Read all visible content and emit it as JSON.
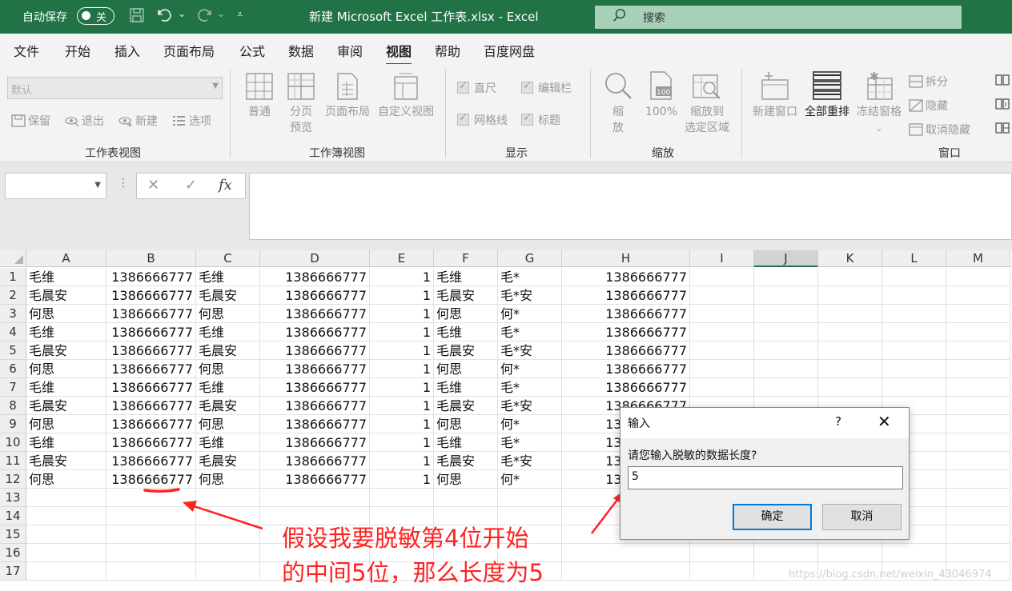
{
  "titlebar": {
    "autosave_label": "自动保存",
    "autosave_state": "关",
    "doc_title": "新建 Microsoft Excel 工作表.xlsx  -  Excel",
    "search_placeholder": "搜索"
  },
  "menu": [
    "文件",
    "开始",
    "插入",
    "页面布局",
    "公式",
    "数据",
    "审阅",
    "视图",
    "帮助",
    "百度网盘"
  ],
  "active_menu": "视图",
  "ribbon": {
    "sheet_view": {
      "select_value": "默认",
      "keep": "保留",
      "exit": "退出",
      "new": "新建",
      "options": "选项",
      "label": "工作表视图"
    },
    "workbook_view": {
      "normal": "普通",
      "page_break": "分页",
      "page_break2": "预览",
      "page_layout": "页面布局",
      "custom": "自定义视图",
      "label": "工作簿视图"
    },
    "show": {
      "ruler": "直尺",
      "formula_bar": "编辑栏",
      "gridlines": "网格线",
      "headings": "标题",
      "label": "显示"
    },
    "zoom": {
      "zoom": "缩",
      "zoom2": "放",
      "hundred": "100%",
      "to_sel": "缩放到",
      "to_sel2": "选定区域",
      "label": "缩放"
    },
    "window": {
      "new_window": "新建窗口",
      "arrange_all": "全部重排",
      "freeze": "冻结窗格",
      "split": "拆分",
      "hide": "隐藏",
      "unhide": "取消隐藏",
      "label": "窗口"
    }
  },
  "formula": {
    "cancel": "✕",
    "enter": "✓",
    "fx": "fx"
  },
  "columns": [
    "A",
    "B",
    "C",
    "D",
    "E",
    "F",
    "G",
    "H",
    "I",
    "J",
    "K",
    "L",
    "M"
  ],
  "selected_column": "J",
  "rows": [
    "1",
    "2",
    "3",
    "4",
    "5",
    "6",
    "7",
    "8",
    "9",
    "10",
    "11",
    "12",
    "13",
    "14",
    "15",
    "16",
    "17"
  ],
  "table": [
    [
      "毛维",
      "1386666777",
      "毛维",
      "1386666777",
      "1",
      "毛维",
      "毛*",
      "1386666777"
    ],
    [
      "毛晨安",
      "1386666777",
      "毛晨安",
      "1386666777",
      "1",
      "毛晨安",
      "毛*安",
      "1386666777"
    ],
    [
      "何思",
      "1386666777",
      "何思",
      "1386666777",
      "1",
      "何思",
      "何*",
      "1386666777"
    ],
    [
      "毛维",
      "1386666777",
      "毛维",
      "1386666777",
      "1",
      "毛维",
      "毛*",
      "1386666777"
    ],
    [
      "毛晨安",
      "1386666777",
      "毛晨安",
      "1386666777",
      "1",
      "毛晨安",
      "毛*安",
      "1386666777"
    ],
    [
      "何思",
      "1386666777",
      "何思",
      "1386666777",
      "1",
      "何思",
      "何*",
      "1386666777"
    ],
    [
      "毛维",
      "1386666777",
      "毛维",
      "1386666777",
      "1",
      "毛维",
      "毛*",
      "1386666777"
    ],
    [
      "毛晨安",
      "1386666777",
      "毛晨安",
      "1386666777",
      "1",
      "毛晨安",
      "毛*安",
      "1386666777"
    ],
    [
      "何思",
      "1386666777",
      "何思",
      "1386666777",
      "1",
      "何思",
      "何*",
      "1386666777"
    ],
    [
      "毛维",
      "1386666777",
      "毛维",
      "1386666777",
      "1",
      "毛维",
      "毛*",
      "1386666777"
    ],
    [
      "毛晨安",
      "1386666777",
      "毛晨安",
      "1386666777",
      "1",
      "毛晨安",
      "毛*安",
      "1386666777"
    ],
    [
      "何思",
      "1386666777",
      "何思",
      "1386666777",
      "1",
      "何思",
      "何*",
      "1386666777"
    ]
  ],
  "dialog": {
    "title": "输入",
    "help": "?",
    "close": "✕",
    "prompt": "请您输入脱敏的数据长度?",
    "value": "5",
    "ok": "确定",
    "cancel": "取消"
  },
  "annotation": {
    "line1": "假设我要脱敏第4位开始",
    "line2": "的中间5位，那么长度为5",
    "color": "#ff2222"
  },
  "watermark": "https://blog.csdn.net/weixin_43046974",
  "colors": {
    "excel_green": "#217346",
    "accent_blue": "#0078d7"
  }
}
